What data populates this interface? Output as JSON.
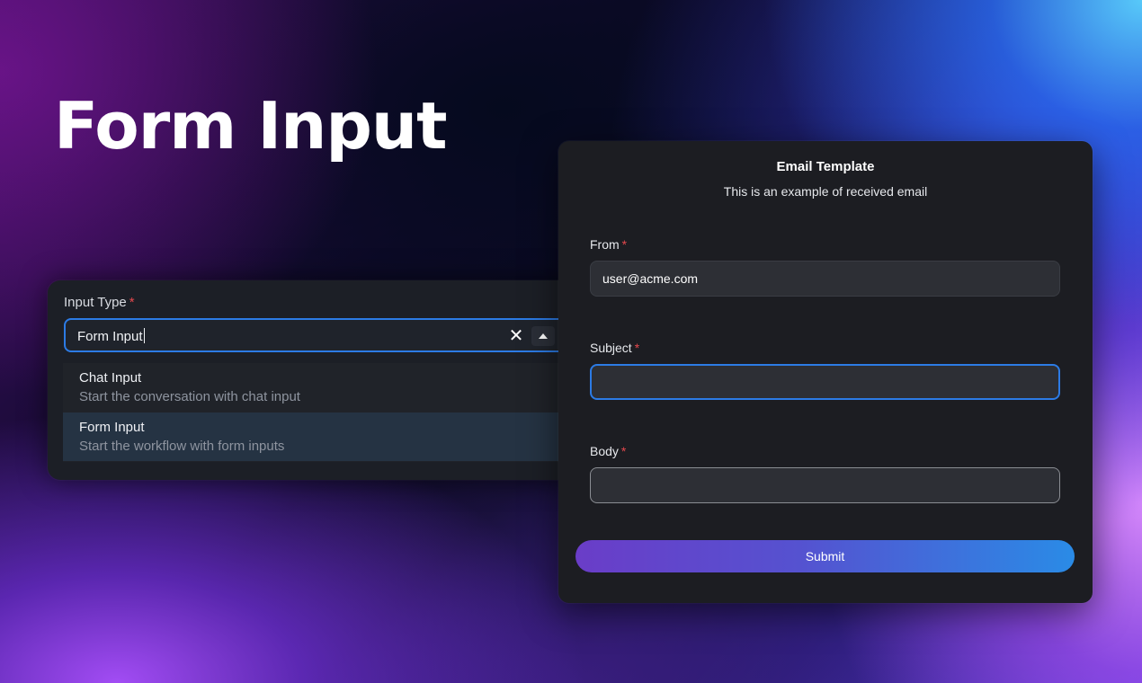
{
  "hero": {
    "title": "Form Input"
  },
  "input_type": {
    "label": "Input Type",
    "required_mark": "*",
    "value": "Form Input",
    "clear_symbol": "✕",
    "options": [
      {
        "title": "Chat Input",
        "description": "Start the conversation with chat input",
        "selected": false
      },
      {
        "title": "Form Input",
        "description": "Start the workflow with form inputs",
        "selected": true
      }
    ]
  },
  "email_card": {
    "title": "Email Template",
    "subtitle": "This is an example of received email",
    "fields": [
      {
        "label": "From",
        "required_mark": "*",
        "value": "user@acme.com"
      },
      {
        "label": "Subject",
        "required_mark": "*",
        "value": ""
      },
      {
        "label": "Body",
        "required_mark": "*",
        "value": ""
      }
    ],
    "submit_label": "Submit"
  },
  "colors": {
    "accent": "#2c7be5",
    "required": "#e5484d",
    "button_gradient_start": "#6a3dc8",
    "button_gradient_end": "#2a8be6",
    "card_background": "#1c1d22"
  }
}
